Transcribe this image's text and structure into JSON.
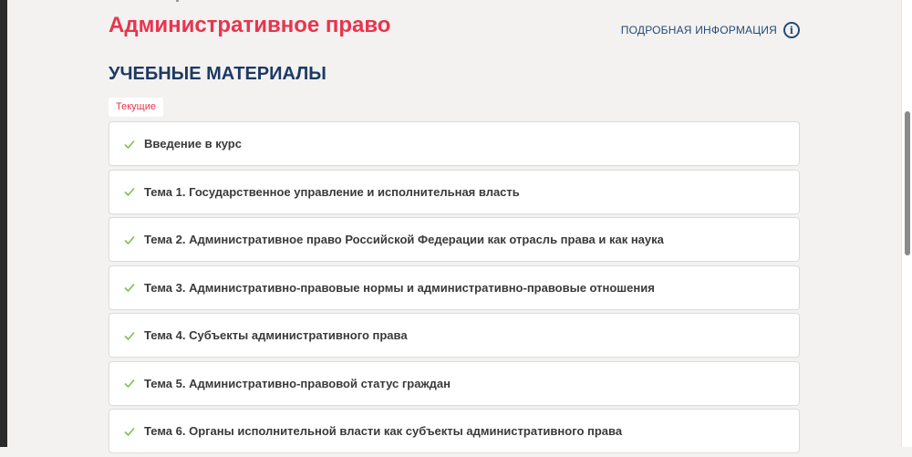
{
  "course": {
    "title": "Административное право",
    "info_link_label": "ПОДРОБНАЯ ИНФОРМАЦИЯ",
    "info_icon": "info-circle-icon"
  },
  "materials": {
    "section_title": "УЧЕБНЫЕ МАТЕРИАЛЫ",
    "tab_current_label": "Текущие",
    "items": [
      {
        "label": "Введение в курс",
        "status_icon": "check-icon"
      },
      {
        "label": "Тема 1. Государственное управление и исполнительная власть",
        "status_icon": "check-icon"
      },
      {
        "label": "Тема 2. Административное право Российской Федерации как отрасль права и как наука",
        "status_icon": "check-icon"
      },
      {
        "label": "Тема 3. Административно-правовые нормы и административно-правовые отношения",
        "status_icon": "check-icon"
      },
      {
        "label": "Тема 4. Субъекты административного права",
        "status_icon": "check-icon"
      },
      {
        "label": "Тема 5. Административно-правовой статус граждан",
        "status_icon": "check-icon"
      },
      {
        "label": "Тема 6. Органы исполнительной власти как субъекты административного права",
        "status_icon": "check-icon"
      }
    ]
  },
  "colors": {
    "title": "#e8344e",
    "section_title": "#1d3a63",
    "link": "#234b7a",
    "check": "#7cc243",
    "background": "#f3f2f0"
  }
}
